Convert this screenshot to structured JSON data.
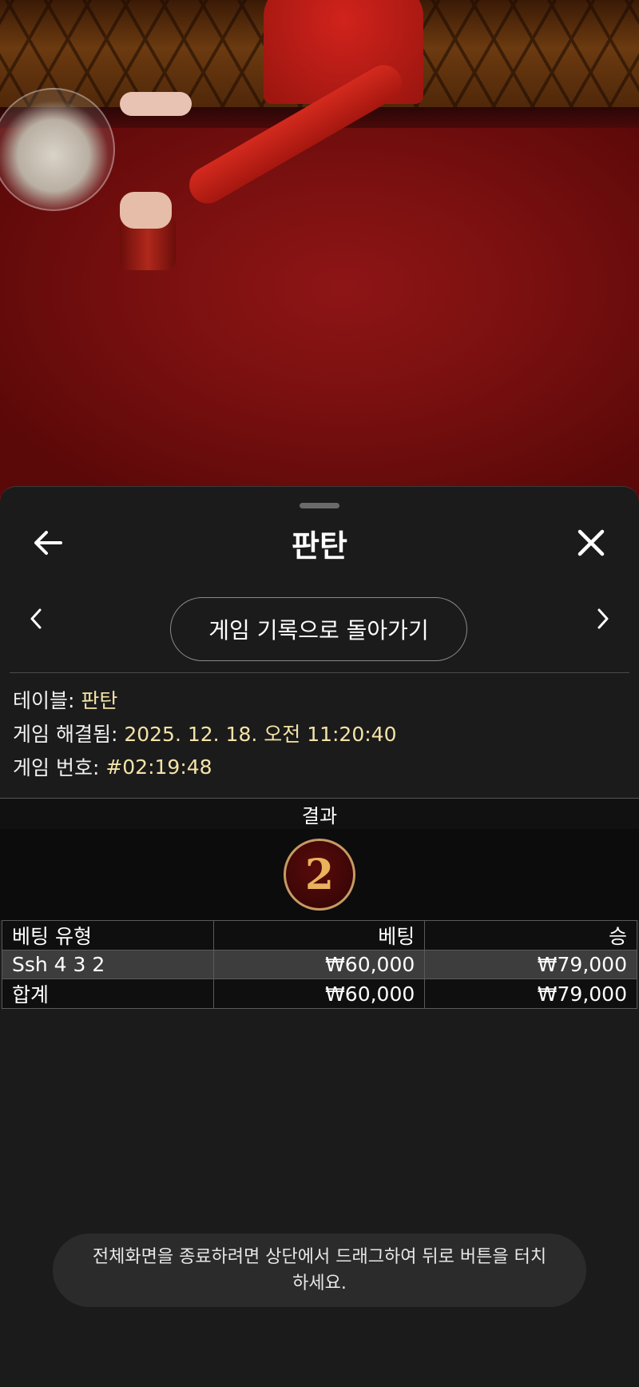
{
  "header": {
    "title": "판탄",
    "back_icon": "arrow-left-icon",
    "close_icon": "close-icon"
  },
  "navigation": {
    "prev_icon": "chevron-left-icon",
    "next_icon": "chevron-right-icon",
    "back_to_history_label": "게임 기록으로 돌아가기"
  },
  "game_info": {
    "table_label": "테이블:",
    "table_value": "판탄",
    "resolved_label": "게임 해결됨:",
    "resolved_value": "2025. 12. 18. 오전 11:20:40",
    "game_number_label": "게임 번호:",
    "game_number_value": "#02:19:48"
  },
  "result": {
    "header": "결과",
    "value": "2"
  },
  "bets_table": {
    "columns": [
      "베팅 유형",
      "베팅",
      "승"
    ],
    "rows": [
      {
        "type": "Ssh 4 3 2",
        "bet": "₩60,000",
        "win": "₩79,000"
      }
    ],
    "total": {
      "label": "합계",
      "bet": "₩60,000",
      "win": "₩79,000"
    }
  },
  "toast": {
    "message": "전체화면을 종료하려면 상단에서 드래그하여 뒤로 버튼을 터치하세요."
  },
  "colors": {
    "sheet_background": "#1b1b1b",
    "info_value": "#f4e3a8",
    "result_ball_border": "#c79a62",
    "result_ball_digit": "#e9b25c",
    "table_felt": "#7a1010"
  }
}
